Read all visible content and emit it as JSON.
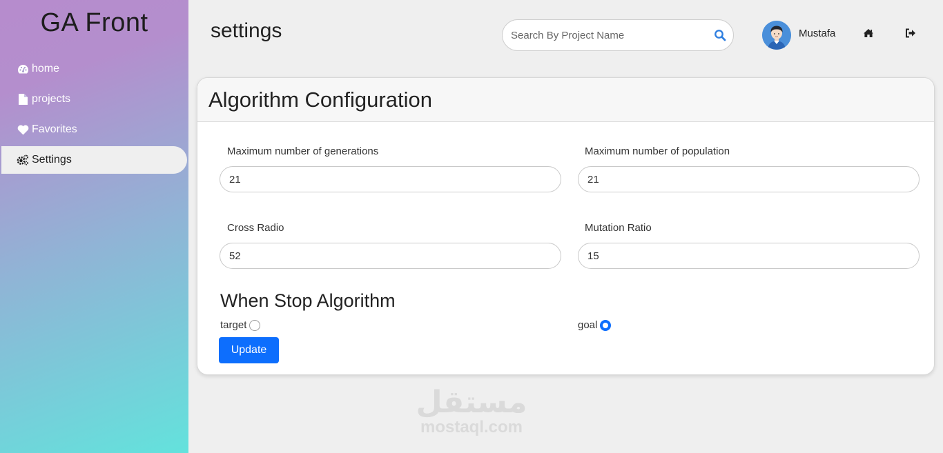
{
  "app": {
    "brand": "GA Front"
  },
  "sidebar": {
    "items": [
      {
        "label": "home",
        "icon": "dashboard-icon",
        "active": false
      },
      {
        "label": "projects",
        "icon": "file-icon",
        "active": false
      },
      {
        "label": "Favorites",
        "icon": "heart-icon",
        "active": false
      },
      {
        "label": "Settings",
        "icon": "gears-icon",
        "active": true
      }
    ]
  },
  "header": {
    "title": "settings",
    "search_placeholder": "Search By Project Name",
    "search_icon": "search-icon",
    "username": "Mustafa",
    "home_icon": "home-icon",
    "logout_icon": "sign-out-icon"
  },
  "config": {
    "title": "Algorithm Configuration",
    "fields": {
      "max_generations": {
        "label": "Maximum number of generations",
        "value": "21"
      },
      "max_population": {
        "label": "Maximum number of population",
        "value": "21"
      },
      "cross_ratio": {
        "label": "Cross Radio",
        "value": "52"
      },
      "mutation_ratio": {
        "label": "Mutation Ratio",
        "value": "15"
      }
    },
    "stop_section": {
      "title": "When Stop Algorithm",
      "options": [
        {
          "label": "target",
          "checked": false
        },
        {
          "label": "goal",
          "checked": true
        }
      ]
    },
    "update_label": "Update"
  },
  "watermark": {
    "arabic": "مستقل",
    "latin": "mostaql.com"
  },
  "colors": {
    "accent": "#0d6efd",
    "sidebar_top": "#b68ccd",
    "sidebar_bottom": "#63e2dc",
    "background": "#efefef"
  }
}
